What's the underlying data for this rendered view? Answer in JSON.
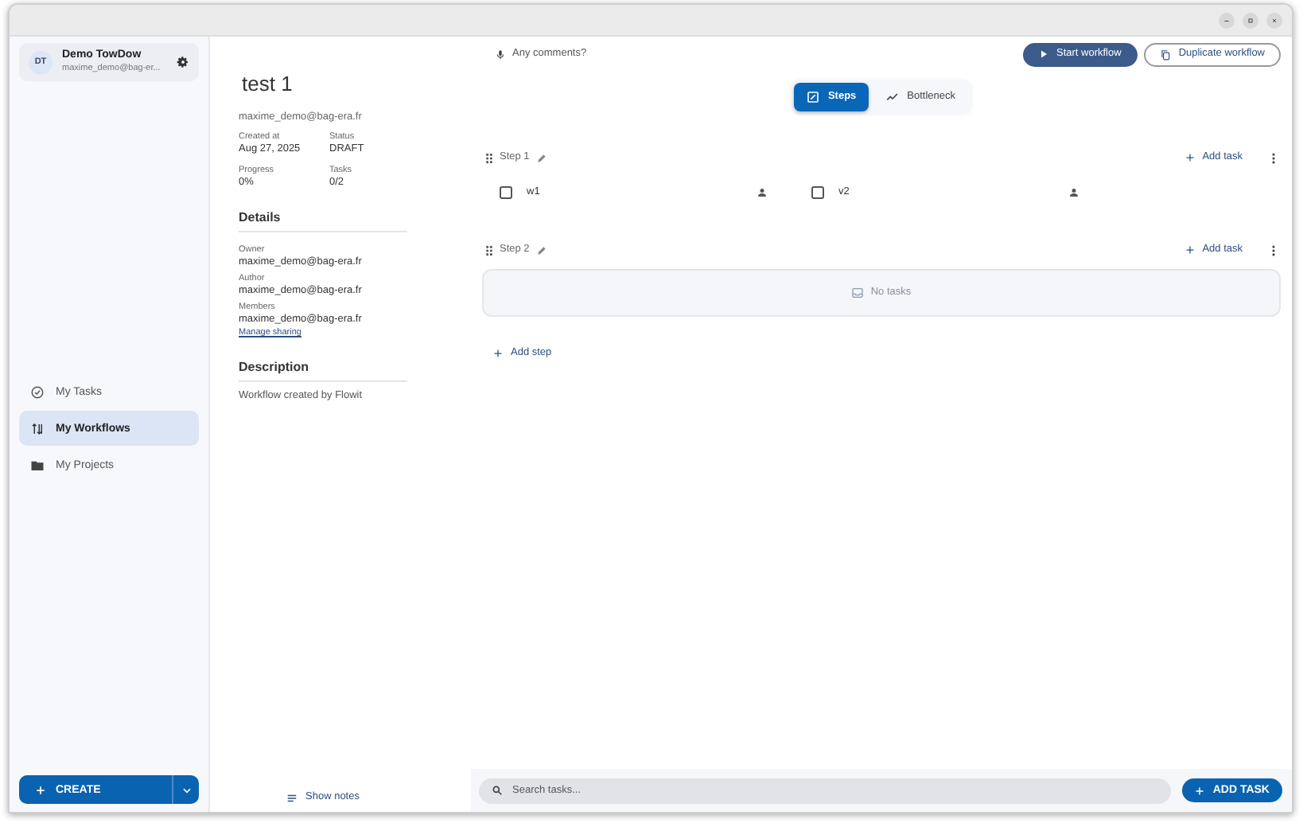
{
  "sidebar": {
    "profile": {
      "initials": "DT",
      "name": "Demo TowDow",
      "email": "maxime_demo@bag-er..."
    },
    "nav": [
      {
        "label": "My Tasks",
        "selected": false
      },
      {
        "label": "My Workflows",
        "selected": true
      },
      {
        "label": "My Projects",
        "selected": false
      }
    ],
    "create_button": "CREATE"
  },
  "details": {
    "title": "test 1",
    "owner_line": "maxime_demo@bag-era.fr",
    "meta": [
      {
        "label": "Created at",
        "value": "Aug 27, 2025"
      },
      {
        "label": "Status",
        "value": "DRAFT"
      },
      {
        "label": "Progress",
        "value": "0%"
      },
      {
        "label": "Tasks",
        "value": "0/2"
      }
    ],
    "details_heading": "Details",
    "fields": [
      {
        "label": "Owner",
        "value": "maxime_demo@bag-era.fr"
      },
      {
        "label": "Author",
        "value": "maxime_demo@bag-era.fr"
      },
      {
        "label": "Members",
        "value": "maxime_demo@bag-era.fr"
      }
    ],
    "manage_sharing": "Manage sharing",
    "description_heading": "Description",
    "description": "Workflow created by Flowit",
    "show_notes": "Show notes"
  },
  "main": {
    "comments_prompt": "Any comments?",
    "actions": [
      {
        "label": "Start workflow",
        "kind": "primary"
      },
      {
        "label": "Duplicate workflow",
        "kind": "outline"
      }
    ],
    "view_tabs": [
      {
        "label": "Steps",
        "selected": true
      },
      {
        "label": "Bottleneck",
        "selected": false
      }
    ],
    "steps": [
      {
        "name": "Step 1",
        "add_task": "Add task",
        "tasks": [
          {
            "name": "w1",
            "checked": false
          },
          {
            "name": "v2",
            "checked": false
          }
        ]
      },
      {
        "name": "Step 2",
        "add_task": "Add task",
        "empty_text": "No tasks"
      }
    ],
    "add_step": "Add step",
    "search": {
      "placeholder": "Search tasks..."
    },
    "add_task_button": "ADD TASK"
  }
}
